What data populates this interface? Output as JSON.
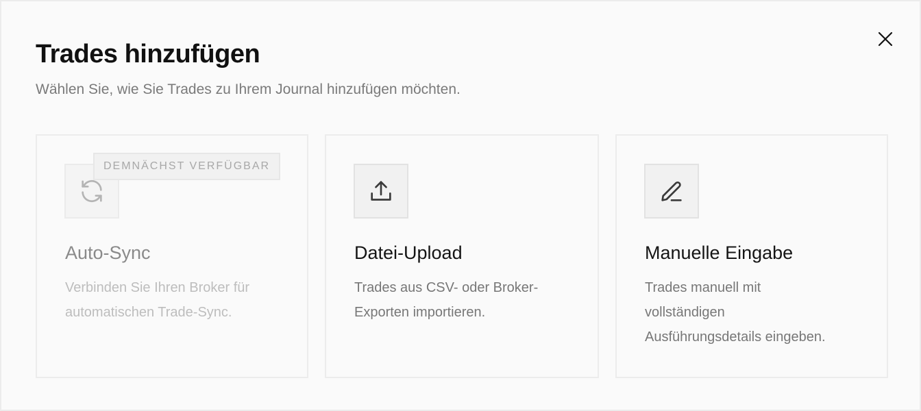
{
  "dialog": {
    "title": "Trades hinzufügen",
    "subtitle": "Wählen Sie, wie Sie Trades zu Ihrem Journal hinzufügen möchten.",
    "close_icon": "close-icon"
  },
  "options": [
    {
      "title": "Auto-Sync",
      "description_lines": [
        "Verbinden Sie Ihren Broker für",
        "automatischen Trade-Sync."
      ],
      "icon": "refresh-icon",
      "badge": "DEMNÄCHST VERFÜGBAR",
      "enabled": false
    },
    {
      "title": "Datei-Upload",
      "description_lines": [
        "Trades aus CSV- oder Broker-",
        "Exporten importieren."
      ],
      "icon": "upload-icon",
      "enabled": true
    },
    {
      "title": "Manuelle Eingabe",
      "description_lines": [
        "Trades manuell mit",
        "vollständigen",
        "Ausführungsdetails eingeben."
      ],
      "icon": "pencil-icon",
      "enabled": true
    }
  ],
  "colors": {
    "background": "#fafafa",
    "border": "#ececec",
    "title": "#111111",
    "muted": "#7a7a7a",
    "disabled_text": "#bdbdbd"
  }
}
